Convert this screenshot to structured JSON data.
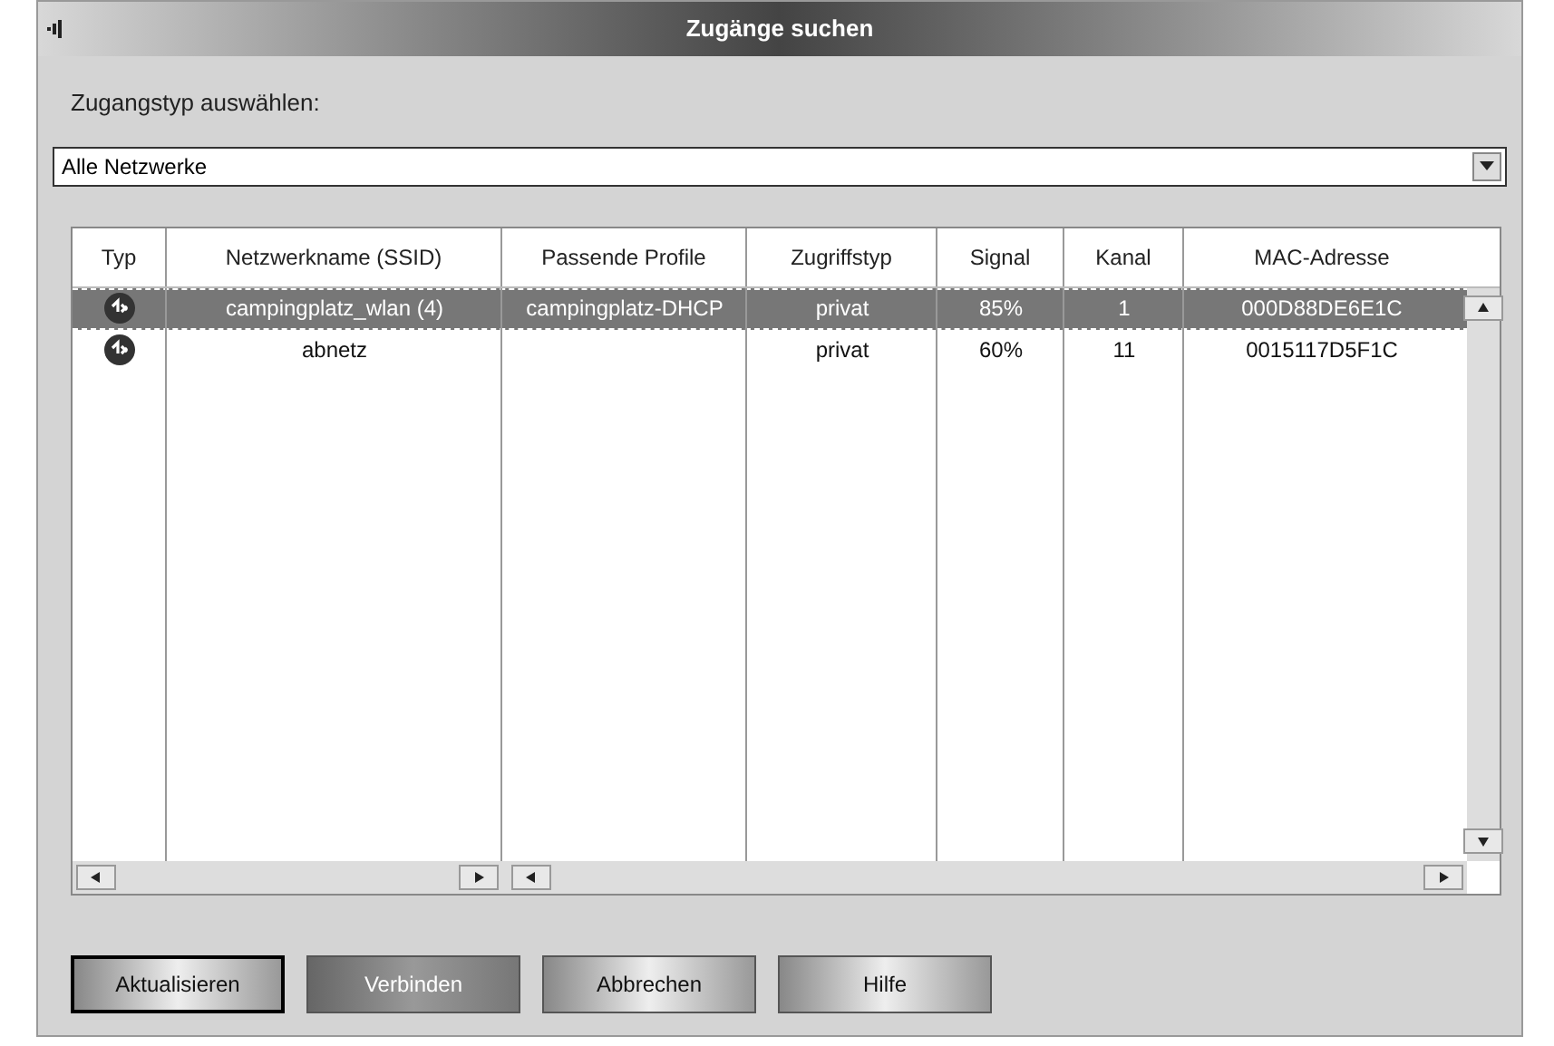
{
  "window": {
    "title": "Zugänge suchen"
  },
  "filter": {
    "label": "Zugangstyp auswählen:",
    "value": "Alle Netzwerke"
  },
  "table": {
    "columns": [
      "Typ",
      "Netzwerkname (SSID)",
      "Passende Profile",
      "Zugriffstyp",
      "Signal",
      "Kanal",
      "MAC-Adresse"
    ],
    "rows": [
      {
        "selected": true,
        "cells": [
          "",
          "campingplatz_wlan (4)",
          "campingplatz-DHCP",
          "privat",
          "85%",
          "1",
          "000D88DE6E1C"
        ]
      },
      {
        "selected": false,
        "cells": [
          "",
          "abnetz",
          "",
          "privat",
          "60%",
          "11",
          "0015117D5F1C"
        ]
      }
    ]
  },
  "buttons": [
    {
      "label": "Aktualisieren",
      "disabled": false,
      "default": true
    },
    {
      "label": "Verbinden",
      "disabled": true,
      "default": false
    },
    {
      "label": "Abbrechen",
      "disabled": false,
      "default": false
    },
    {
      "label": "Hilfe",
      "disabled": false,
      "default": false
    }
  ]
}
